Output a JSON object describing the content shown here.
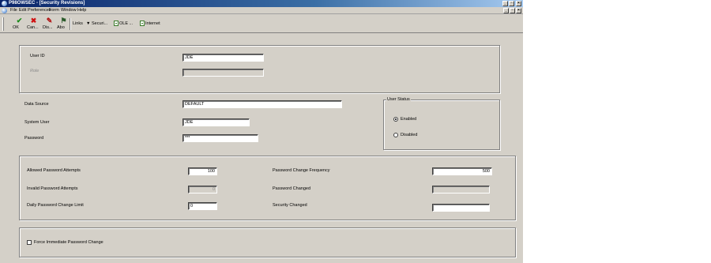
{
  "window": {
    "title": "P98OWSEC - [Security Revisions]",
    "controls": {
      "minimize": "_",
      "restore": "▫",
      "close": "×"
    }
  },
  "menu": {
    "items": [
      "File",
      "Edit",
      "Preferences",
      "Form",
      "Window",
      "Help"
    ],
    "mdi_controls": {
      "minimize": "_",
      "restore": "▫",
      "close": "×"
    }
  },
  "toolbar": {
    "ok_label": "OK",
    "cancel_label": "Can...",
    "display_label": "Dis...",
    "about_label": "Abo",
    "links_label": "Links",
    "security_label": "Securi...",
    "ole_label": "OLE ...",
    "internet_label": "Internet"
  },
  "user": {
    "user_id_label": "User ID",
    "user_id_value": "JDE",
    "role_label": "Role",
    "role_value": ""
  },
  "details": {
    "data_source_label": "Data Source",
    "data_source_value": "DEFAULT",
    "system_user_label": "System User",
    "system_user_value": "JDE",
    "password_label": "Password",
    "password_value": "***"
  },
  "user_status": {
    "title": "User Status",
    "enabled_label": "Enabled",
    "disabled_label": "Disabled",
    "selected": "Enabled"
  },
  "password_settings": {
    "allowed_attempts_label": "Allowed Password Attempts",
    "allowed_attempts_value": "100",
    "invalid_attempts_label": "Invalid Password Attempts",
    "invalid_attempts_value": "0",
    "daily_limit_label": "Daily Password Change Limit",
    "daily_limit_value": "0",
    "change_frequency_label": "Password Change Frequency",
    "change_frequency_value": "500",
    "password_changed_label": "Password Changed",
    "password_changed_value": "",
    "security_changed_label": "Security Changed",
    "security_changed_value": ""
  },
  "options": {
    "force_change_label": "Force Immediate Password Change",
    "force_change_checked": false
  }
}
